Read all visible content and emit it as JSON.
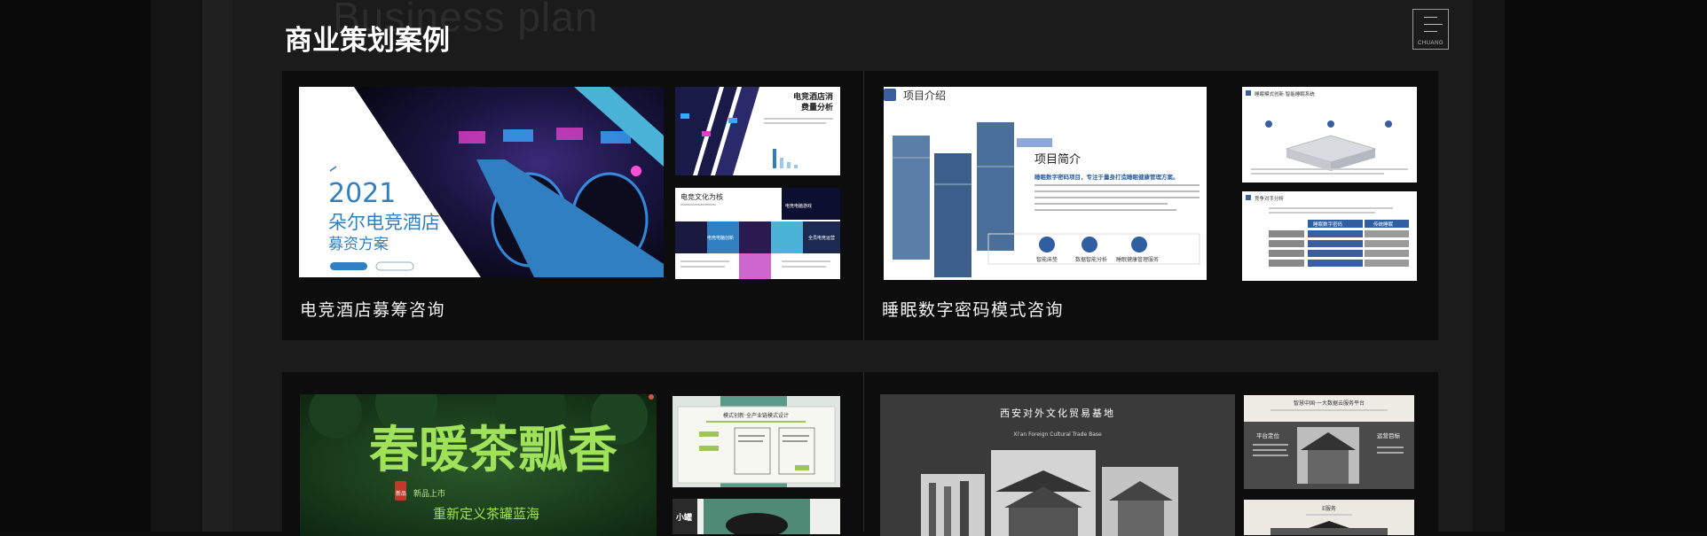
{
  "page": {
    "ghost_title": "Business plan",
    "title": "商业策划案例"
  },
  "logo": {
    "text": "CHUANG"
  },
  "cases": [
    {
      "title": "电竞酒店募筹咨询",
      "main": {
        "year": "2021",
        "name": "朵尔电竞酒店",
        "sub": "募资方案"
      },
      "side_top": {
        "title": "电竞酒店消费量分析"
      },
      "side_bottom": {
        "title": "电竞文化为核",
        "label1": "电竞电脑创新",
        "label2": "电竞主题装修",
        "label3": "电竞文化服务",
        "label4": "全员电竞运营"
      }
    },
    {
      "title": "睡眠数字密码模式咨询",
      "main": {
        "section": "项目介绍",
        "heading": "项目简介",
        "tagline": "睡眠数字密码项目，专注于量身打造睡眠健康管理方案。",
        "icon1": "智能床垫",
        "icon2": "数据智能分析",
        "icon3": "睡眠健康管理服务"
      },
      "side_top": {
        "title": "睡眠模式创新·智能睡眠系统"
      },
      "side_bottom": {
        "title": "竞争对手分析",
        "col1": "睡眠数字密码",
        "col2": "传统睡眠"
      }
    },
    {
      "title": "春暖茶瓢香",
      "main": {
        "brand": "春暖茶瓢香",
        "badge": "新品",
        "tag": "新品上市",
        "slogan": "重新定义茶罐蓝海"
      },
      "side_top": {
        "title": "模式创新·全产业链模式设计"
      },
      "side_bottom": {
        "title": "小罐"
      }
    },
    {
      "title": "西安对外文化贸易基地",
      "main": {
        "title": "西安对外文化贸易基地",
        "subtitle": "Xi'an Foreign Cultural Trade Base"
      },
      "side_top": {
        "title": "智慧中国·一大数据云服务平台",
        "left": "平台定位",
        "right": "运营目标"
      },
      "side_bottom": {
        "title": "E服务"
      }
    }
  ],
  "colors": {
    "accent_blue": "#2f7fc1",
    "tea_green": "#9fe25a",
    "card_bg": "#0d0d0d",
    "panel_bg": "#1b1b1b"
  }
}
